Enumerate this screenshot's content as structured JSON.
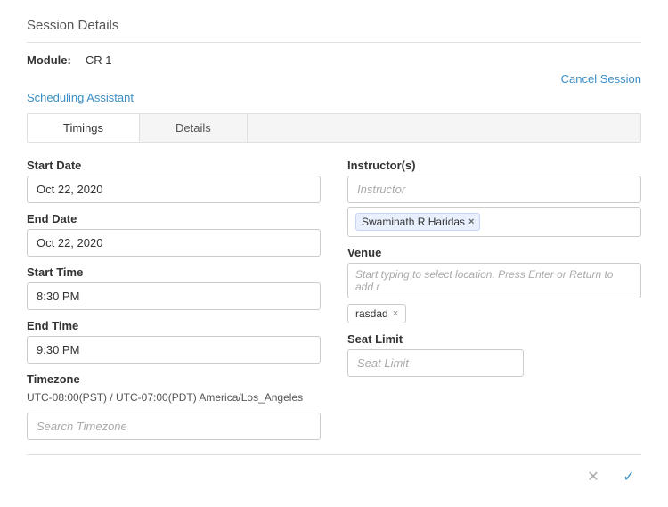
{
  "header": {
    "title": "Session Details",
    "module_label": "Module:",
    "module_value": "CR 1",
    "cancel_session_label": "Cancel Session",
    "scheduling_assistant_label": "Scheduling Assistant"
  },
  "tabs": [
    {
      "id": "timings",
      "label": "Timings",
      "active": true
    },
    {
      "id": "details",
      "label": "Details",
      "active": false
    }
  ],
  "left_col": {
    "start_date_label": "Start Date",
    "start_date_value": "Oct 22, 2020",
    "end_date_label": "End Date",
    "end_date_value": "Oct 22, 2020",
    "start_time_label": "Start Time",
    "start_time_value": "8:30 PM",
    "end_time_label": "End Time",
    "end_time_value": "9:30 PM",
    "timezone_label": "Timezone",
    "timezone_text": "UTC-08:00(PST) / UTC-07:00(PDT) America/Los_Angeles",
    "timezone_placeholder": "Search Timezone"
  },
  "right_col": {
    "instructors_label": "Instructor(s)",
    "instructor_placeholder": "Instructor",
    "instructor_tag": "Swaminath R Haridas",
    "venue_label": "Venue",
    "venue_placeholder": "Start typing to select location. Press Enter or Return to add r",
    "venue_tag": "rasdad",
    "seat_limit_label": "Seat Limit",
    "seat_limit_placeholder": "Seat Limit"
  },
  "actions": {
    "cancel_icon": "✕",
    "confirm_icon": "✓"
  }
}
